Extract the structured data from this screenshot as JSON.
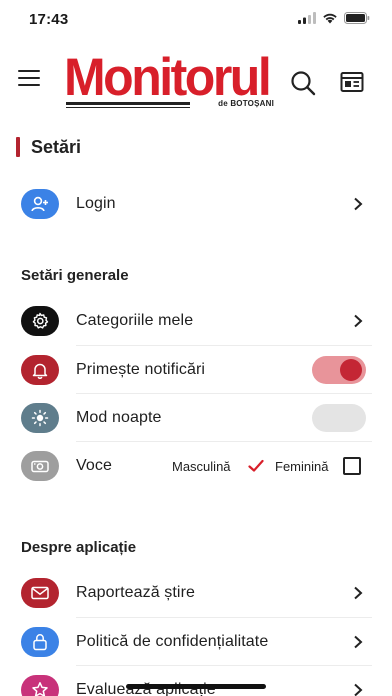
{
  "status": {
    "time": "17:43"
  },
  "header": {
    "logo_text": "Monitorul",
    "logo_subtitle": "de BOTOȘANI"
  },
  "page": {
    "title": "Setări"
  },
  "login": {
    "label": "Login",
    "icon": "add-user-icon",
    "icon_bg": "#3b82e6"
  },
  "general": {
    "section_title": "Setări generale",
    "categories": {
      "label": "Categoriile mele",
      "icon": "gear-icon",
      "icon_bg": "#111111"
    },
    "notifications": {
      "label": "Primește notificări",
      "icon": "bell-icon",
      "icon_bg": "#b3242f",
      "enabled": true
    },
    "night_mode": {
      "label": "Mod noapte",
      "icon": "sun-icon",
      "icon_bg": "#5f7d8c",
      "enabled": false
    },
    "voice": {
      "label": "Voce",
      "icon": "camera-icon",
      "icon_bg": "#9e9e9e",
      "male_label": "Masculină",
      "female_label": "Feminină",
      "selected": "Masculină"
    }
  },
  "about": {
    "section_title": "Despre aplicație",
    "report": {
      "label": "Raportează știre",
      "icon": "mail-icon",
      "icon_bg": "#b3242f"
    },
    "privacy": {
      "label": "Politică de confidențialitate",
      "icon": "lock-icon",
      "icon_bg": "#3b82e6"
    },
    "rate": {
      "label": "Evaluează aplicație",
      "icon": "star-icon",
      "icon_bg": "#c8327a"
    }
  },
  "colors": {
    "accent": "#b3242f",
    "brand": "#d81f2a",
    "toggle_on_track": "#e8949a"
  }
}
